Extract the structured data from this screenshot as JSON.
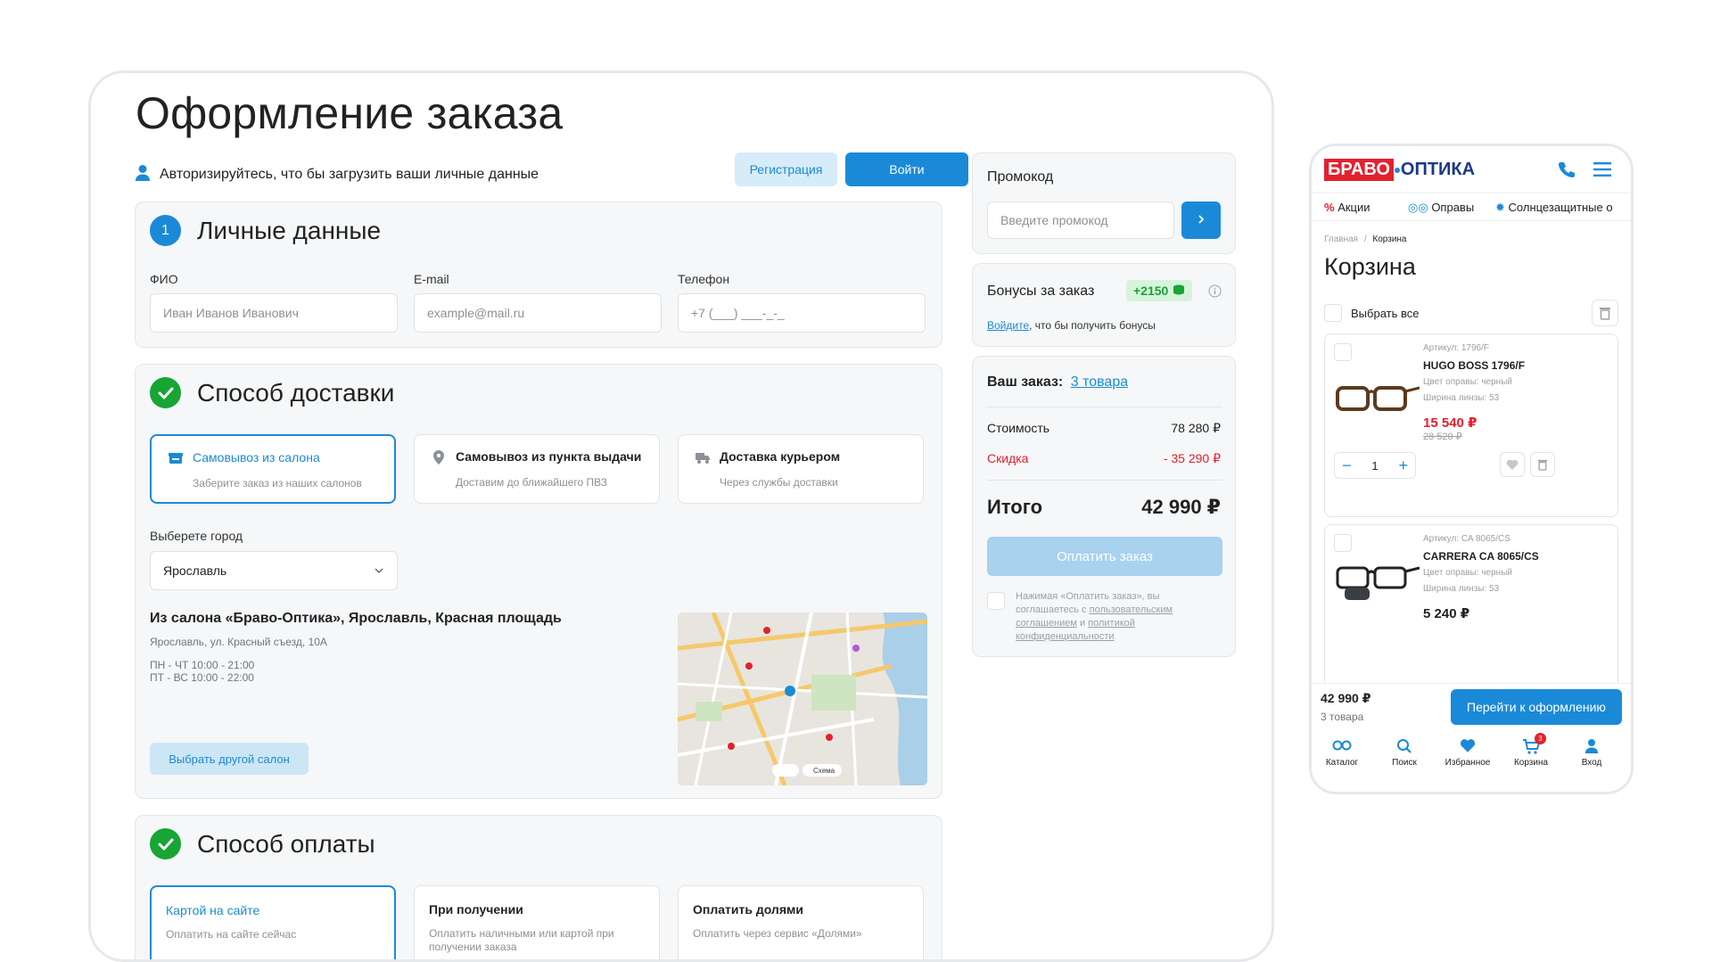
{
  "page_title": "Оформление заказа",
  "auth": {
    "text": "Авторизируйтесь, что бы загрузить ваши личные данные",
    "register": "Регистрация",
    "login": "Войти"
  },
  "personal": {
    "step": "1",
    "title": "Личные данные",
    "fio_label": "ФИО",
    "fio_placeholder": "Иван Иванов Иванович",
    "email_label": "E-mail",
    "email_placeholder": "example@mail.ru",
    "phone_label": "Телефон",
    "phone_placeholder": "+7 (___) ___-_-_"
  },
  "delivery": {
    "title": "Способ доставки",
    "options": [
      {
        "title": "Самовывоз из салона",
        "sub": "Заберите заказ из наших салонов"
      },
      {
        "title": "Самовывоз из пункта выдачи",
        "sub": "Доставим до ближайшего ПВЗ"
      },
      {
        "title": "Доставка курьером",
        "sub": "Через службы доставки"
      }
    ],
    "city_label": "Выберете город",
    "city_value": "Ярославль",
    "salon_title": "Из салона «Браво-Оптика», Ярославль, Красная площадь",
    "salon_address": "Ярославль, ул. Красный съезд, 10А",
    "hours_1": "ПН - ЧТ 10:00 - 21:00",
    "hours_2": "ПТ - ВС 10:00 - 22:00",
    "change_salon": "Выбрать другой салон",
    "map_scheme": "Схема"
  },
  "payment": {
    "title": "Способ оплаты",
    "options": [
      {
        "title": "Картой на сайте",
        "sub": "Оплатить на сайте сейчас"
      },
      {
        "title": "При получении",
        "sub": "Оплатить наличными или картой при получении заказа"
      },
      {
        "title": "Оплатить долями",
        "sub": "Оплатить через сервис «Долями»"
      }
    ]
  },
  "promo": {
    "title": "Промокод",
    "placeholder": "Введите промокод"
  },
  "bonus": {
    "title": "Бонусы за заказ",
    "amount": "+2150",
    "login_link": "Войдите",
    "text": ", что бы получить бонусы"
  },
  "order": {
    "label": "Ваш заказ:",
    "items_link": "3 товара",
    "cost_label": "Стоимость",
    "cost_value": "78 280 ₽",
    "discount_label": "Скидка",
    "discount_value": "- 35 290 ₽",
    "total_label": "Итого",
    "total_value": "42 990 ₽",
    "pay_button": "Оплатить заказ",
    "agree_1": "Нажимая «Оплатить заказ», вы",
    "agree_2": "соглашаетесь с ",
    "agree_link1": "пользовательским",
    "agree_link1b": "соглашением",
    "agree_and": " и ",
    "agree_link2": "политикой",
    "agree_link2b": "конфиденциальности"
  },
  "mobile": {
    "logo_left": "БРАВО",
    "logo_right": "ОПТИКА",
    "nav": [
      "Акции",
      "Оправы",
      "Солнцезащитные о"
    ],
    "breadcrumb_home": "Главная",
    "breadcrumb_sep": "/",
    "breadcrumb_current": "Корзина",
    "title": "Корзина",
    "select_all": "Выбрать все",
    "products": [
      {
        "sku": "Артикул: 1796/F",
        "name": "HUGO BOSS 1796/F",
        "frame": "Цвет оправы: черный",
        "lens": "Ширина линзы: 53",
        "price": "15 540 ₽",
        "old_price": "28 520 ₽",
        "qty": "1"
      },
      {
        "sku": "Артикул: CA 8065/CS",
        "name": "CARRERA CA 8065/CS",
        "frame": "Цвет оправы: черный",
        "lens": "Ширина линзы: 53",
        "price": "5 240 ₽"
      }
    ],
    "footer_total": "42 990 ₽",
    "footer_count": "3 товара",
    "checkout": "Перейти к оформлению",
    "tabs": [
      "Каталог",
      "Поиск",
      "Избранное",
      "Корзина",
      "Вход"
    ],
    "cart_badge": "3"
  },
  "colors": {
    "accent": "#1a8ad8",
    "success": "#17a534",
    "danger": "#e4202d"
  }
}
